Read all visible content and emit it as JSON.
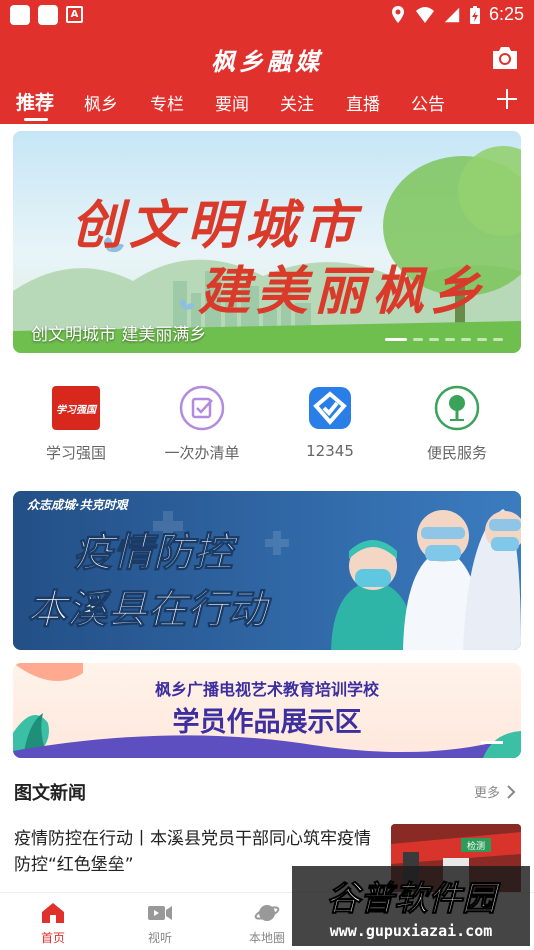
{
  "status_bar": {
    "time": "6:25"
  },
  "header": {
    "app_title": "枫乡融媒",
    "tabs": [
      {
        "label": "推荐",
        "active": true
      },
      {
        "label": "枫乡"
      },
      {
        "label": "专栏"
      },
      {
        "label": "要闻"
      },
      {
        "label": "关注"
      },
      {
        "label": "直播"
      },
      {
        "label": "公告"
      }
    ]
  },
  "banner": {
    "headline_line1": "创文明城市",
    "headline_line2": "建美丽枫乡",
    "caption": "创文明城市 建美丽满乡",
    "slide_count": 7,
    "active_slide": 1
  },
  "quick_links": [
    {
      "label": "学习强国",
      "icon": "xuexi-qiangguo-logo",
      "logo_text": "学习强国"
    },
    {
      "label": "一次办清单",
      "icon": "checklist-icon"
    },
    {
      "label": "12345",
      "icon": "hotline-12345-icon"
    },
    {
      "label": "便民服务",
      "icon": "tree-service-icon"
    }
  ],
  "promo_epidemic": {
    "tagline": "众志成城·共克时艰",
    "line1": "疫情防控",
    "line2": "本溪县在行动"
  },
  "promo_school": {
    "school_name": "枫乡广播电视艺术教育培训学校",
    "title": "学员作品展示区"
  },
  "section": {
    "title": "图文新闻",
    "more_label": "更多"
  },
  "news": [
    {
      "title": "疫情防控在行动丨本溪县党员干部同心筑牢疫情防控“红色堡垒”",
      "thumb_sign": "检测"
    }
  ],
  "bottom_nav": [
    {
      "label": "首页",
      "icon": "home-icon",
      "active": true
    },
    {
      "label": "视听",
      "icon": "video-icon"
    },
    {
      "label": "本地圈",
      "icon": "planet-icon"
    }
  ],
  "watermark": {
    "name": "谷普软件园",
    "url": "www.gupuxiazai.com"
  },
  "colors": {
    "brand_red": "#e0312d",
    "nav_active": "#e0312d"
  }
}
